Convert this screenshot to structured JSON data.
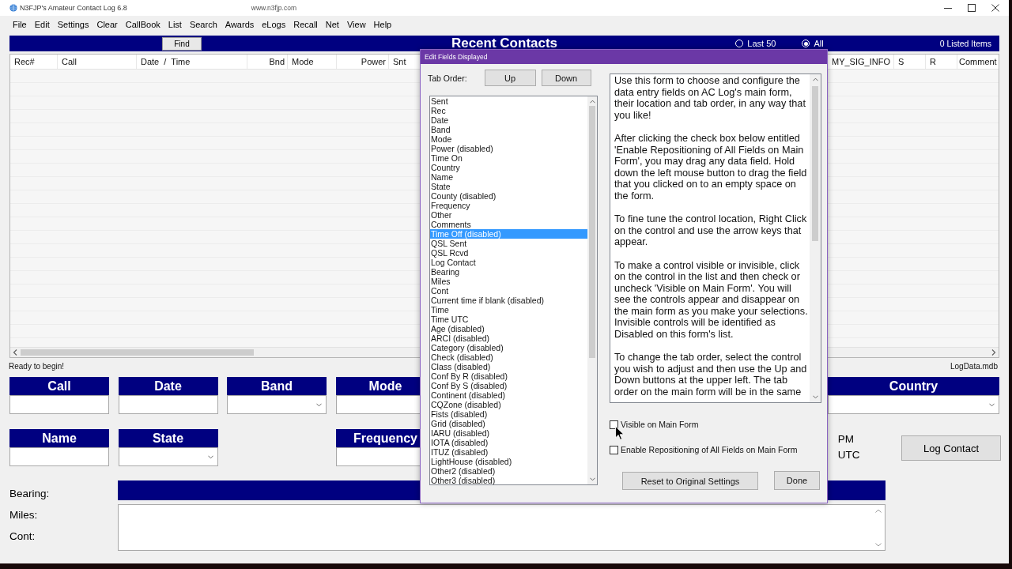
{
  "window": {
    "title": "N3FJP's Amateur Contact Log 6.8",
    "url": "www.n3fjp.com"
  },
  "menu": [
    "File",
    "Edit",
    "Settings",
    "Clear",
    "CallBook",
    "List",
    "Search",
    "Awards",
    "eLogs",
    "Recall",
    "Net",
    "View",
    "Help"
  ],
  "header": {
    "find_button": "Find",
    "title": "Recent Contacts",
    "filters": [
      {
        "label": "Last 50",
        "selected": false
      },
      {
        "label": "All",
        "selected": true
      }
    ],
    "count": "0 Listed Items"
  },
  "table": {
    "columns": [
      "Rec#",
      "Call",
      "Date  /  Time",
      "Bnd",
      "Mode",
      "Power",
      "Snt",
      "MY_SIG_INFO",
      "S",
      "R",
      "Comment"
    ]
  },
  "status_bar": {
    "message": "Ready to begin!",
    "database": "LogData.mdb"
  },
  "form": {
    "rows": [
      [
        {
          "label": "Call",
          "kind": "text"
        },
        {
          "label": "Date",
          "kind": "text"
        },
        {
          "label": "Band",
          "kind": "dropdown"
        },
        {
          "label": "Mode",
          "kind": "text"
        },
        {
          "label": "Country",
          "kind": "dropdown"
        }
      ],
      [
        {
          "label": "Name",
          "kind": "text"
        },
        {
          "label": "State",
          "kind": "dropdown"
        },
        {
          "kind": "empty"
        },
        {
          "label": "Frequency",
          "kind": "text"
        }
      ]
    ],
    "clock": {
      "period": "PM",
      "zone": "UTC"
    },
    "log_contact_button": "Log Contact",
    "info_labels": [
      "Bearing:",
      "Miles:",
      "Cont:"
    ]
  },
  "dialog": {
    "title": "Edit Fields Displayed",
    "tab_order_label": "Tab Order:",
    "up_button": "Up",
    "down_button": "Down",
    "fields_list": [
      {
        "label": "Sent",
        "selected": false
      },
      {
        "label": "Rec",
        "selected": false
      },
      {
        "label": "Date",
        "selected": false
      },
      {
        "label": "Band",
        "selected": false
      },
      {
        "label": "Mode",
        "selected": false
      },
      {
        "label": "Power (disabled)",
        "selected": false
      },
      {
        "label": "Time On",
        "selected": false
      },
      {
        "label": "Country",
        "selected": false
      },
      {
        "label": "Name",
        "selected": false
      },
      {
        "label": "State",
        "selected": false
      },
      {
        "label": "County (disabled)",
        "selected": false
      },
      {
        "label": "Frequency",
        "selected": false
      },
      {
        "label": "Other",
        "selected": false
      },
      {
        "label": "Comments",
        "selected": false
      },
      {
        "label": "Time Off (disabled)",
        "selected": true
      },
      {
        "label": "QSL Sent",
        "selected": false
      },
      {
        "label": "QSL Rcvd",
        "selected": false
      },
      {
        "label": "Log Contact",
        "selected": false
      },
      {
        "label": "Bearing",
        "selected": false
      },
      {
        "label": "Miles",
        "selected": false
      },
      {
        "label": "Cont",
        "selected": false
      },
      {
        "label": "Current time if blank (disabled)",
        "selected": false
      },
      {
        "label": "Time",
        "selected": false
      },
      {
        "label": "Time UTC",
        "selected": false
      },
      {
        "label": "Age (disabled)",
        "selected": false
      },
      {
        "label": "ARCI (disabled)",
        "selected": false
      },
      {
        "label": "Category (disabled)",
        "selected": false
      },
      {
        "label": "Check (disabled)",
        "selected": false
      },
      {
        "label": "Class (disabled)",
        "selected": false
      },
      {
        "label": "Conf By R (disabled)",
        "selected": false
      },
      {
        "label": "Conf By S (disabled)",
        "selected": false
      },
      {
        "label": "Continent (disabled)",
        "selected": false
      },
      {
        "label": "CQZone (disabled)",
        "selected": false
      },
      {
        "label": "Fists (disabled)",
        "selected": false
      },
      {
        "label": "Grid (disabled)",
        "selected": false
      },
      {
        "label": "IARU (disabled)",
        "selected": false
      },
      {
        "label": "IOTA (disabled)",
        "selected": false
      },
      {
        "label": "ITUZ (disabled)",
        "selected": false
      },
      {
        "label": "LightHouse (disabled)",
        "selected": false
      },
      {
        "label": "Other2 (disabled)",
        "selected": false
      },
      {
        "label": "Other3 (disabled)",
        "selected": false
      }
    ],
    "help_text": [
      "Use this form to choose and configure the data entry fields on AC Log's main form, their location and tab order, in any way that you like!",
      "After clicking the check box below entitled 'Enable Repositioning of All Fields on Main Form', you may drag any data field. Hold down the left mouse button to drag the field that you clicked on to an empty space on the form.",
      "To fine tune the control location, Right Click on the control and use the arrow keys that appear.",
      "To make a control visible or invisible, click on the control in the list and then check or uncheck 'Visible on Main Form'. You will see the controls appear and disappear on the main form as you make your selections. Invisible controls will be identified as Disabled on this form's list.",
      "To change the tab order, select the control you wish to adjust and then use the Up and Down buttons at the upper left. The tab order on the main form will be in the same"
    ],
    "checkboxes": [
      {
        "label": "Visible on Main Form",
        "checked": false
      },
      {
        "label": "Enable Repositioning of All Fields on Main Form",
        "checked": false
      }
    ],
    "reset_button": "Reset to Original Settings",
    "done_button": "Done"
  }
}
